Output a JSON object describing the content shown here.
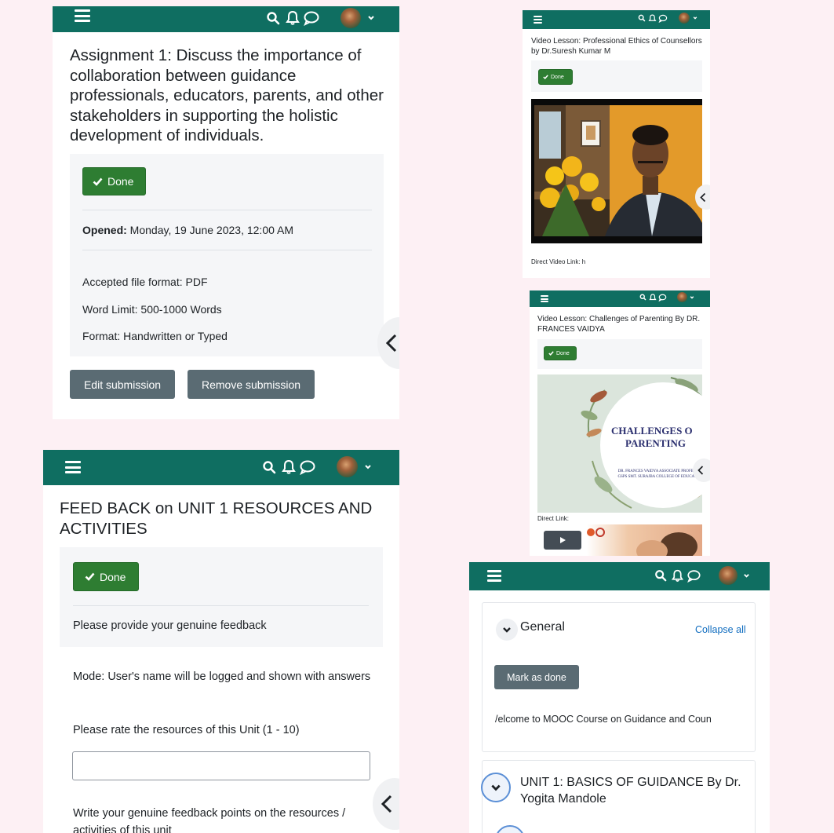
{
  "colors": {
    "brand_navbar": "#0f6e61",
    "done_button": "#2e7d32",
    "secondary_button": "#5a6b73",
    "page_background": "#fdf0f4",
    "link": "#0f6cbf"
  },
  "icons": {
    "menu": "hamburger-menu-icon",
    "search": "search-icon",
    "notifications": "bell-icon",
    "messages": "speech-bubble-icon",
    "user_menu_caret": "chevron-down-icon",
    "done_check": "check-icon",
    "drawer_toggle": "chevron-left-icon",
    "section_toggle": "chevron-down-icon",
    "video_play": "play-icon"
  },
  "assignment": {
    "title": "Assignment 1: Discuss the importance of collaboration between guidance professionals, educators, parents, and other stakeholders in supporting the holistic development of individuals.",
    "done_label": "Done",
    "opened_label": "Opened:",
    "opened_value": " Monday, 19 June 2023, 12:00 AM",
    "lines": [
      "Accepted file format: PDF",
      "Word Limit: 500-1000 Words",
      "Format: Handwritten or Typed"
    ],
    "edit_label": "Edit submission",
    "remove_label": "Remove submission"
  },
  "video_ethics": {
    "title": "Video Lesson: Professional Ethics of Counsellors by Dr.Suresh Kumar M",
    "done_label": "Done",
    "direct_link": "Direct Video Link: h"
  },
  "video_parenting": {
    "title": "Video Lesson: Challenges of Parenting By DR. FRANCES VAIDYA",
    "done_label": "Done",
    "poster_line1": "CHALLENGES O",
    "poster_line2": "PARENTING",
    "poster_sub": "DR. FRANCES VAIDYA ASSOCIATE PROFESSOR GSPS SMT. SURAJBA COLLEGE OF EDUCATION",
    "direct_link": "Direct Link:"
  },
  "feedback": {
    "title": "FEED BACK on UNIT 1 RESOURCES AND ACTIVITIES",
    "done_label": "Done",
    "intro": "Please provide your genuine feedback",
    "mode": "Mode: User's name will be logged and shown with answers",
    "rate_question": "Please rate the resources of this Unit (1 - 10)",
    "rate_value": "",
    "write_question": "Write your genuine feedback points on the resources / activities of this unit"
  },
  "course": {
    "general_label": "General",
    "collapse_label": "Collapse all",
    "mark_done_label": "Mark as done",
    "welcome": "/elcome to MOOC Course on Guidance and Coun",
    "unit1_label": "UNIT 1: BASICS OF GUIDANCE By Dr. Yogita Mandole"
  }
}
